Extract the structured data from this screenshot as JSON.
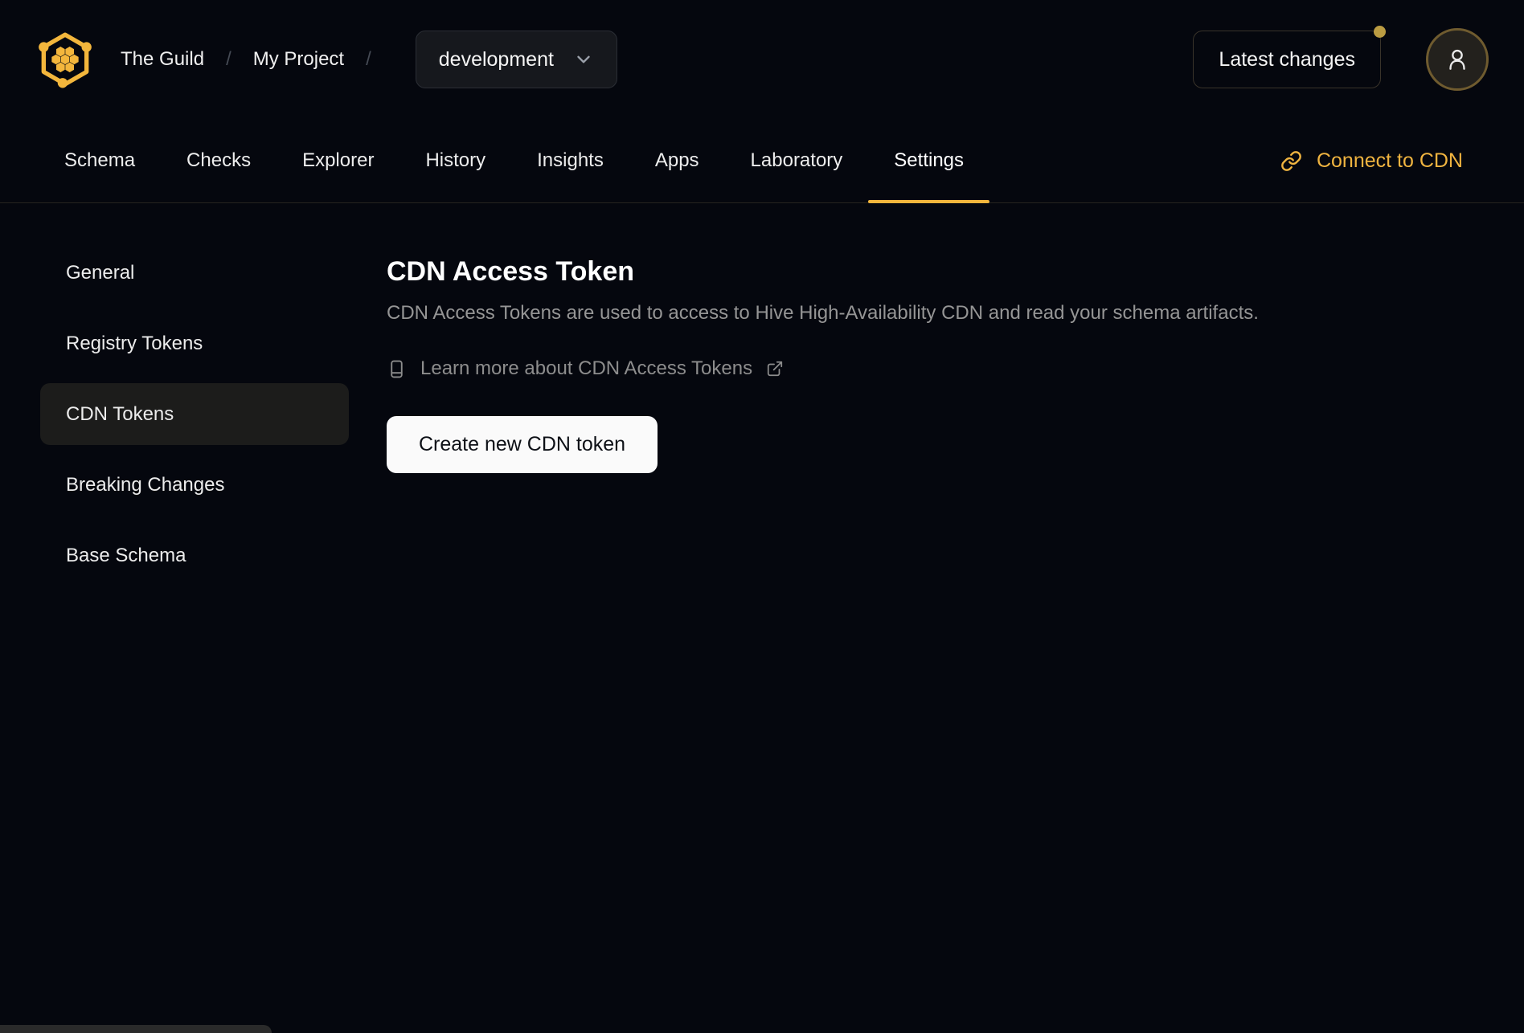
{
  "app": {
    "accent_color": "#f3b63c",
    "background_color": "#05070e"
  },
  "header": {
    "logo_name": "hive-honeycomb-logo",
    "org": "The Guild",
    "separator": "/",
    "project": "My Project",
    "environment": {
      "selected": "development"
    },
    "latest_changes": {
      "label": "Latest changes",
      "has_notification_dot": true,
      "dot_color": "#bb9c42"
    }
  },
  "nav": {
    "tabs": [
      {
        "label": "Schema"
      },
      {
        "label": "Checks"
      },
      {
        "label": "Explorer"
      },
      {
        "label": "History"
      },
      {
        "label": "Insights"
      },
      {
        "label": "Apps"
      },
      {
        "label": "Laboratory"
      },
      {
        "label": "Settings",
        "active": true
      }
    ],
    "connect_cdn": {
      "label": "Connect to CDN",
      "color": "#f0b440",
      "icon": "link-chain-icon"
    }
  },
  "sidebar": {
    "items": [
      {
        "label": "General"
      },
      {
        "label": "Registry Tokens"
      },
      {
        "label": "CDN Tokens",
        "active": true
      },
      {
        "label": "Breaking Changes"
      },
      {
        "label": "Base Schema"
      }
    ]
  },
  "main": {
    "title": "CDN Access Token",
    "description": "CDN Access Tokens are used to access to Hive High-Availability CDN and read your schema artifacts.",
    "learn_more": {
      "label": "Learn more about CDN Access Tokens",
      "leading_icon": "book-icon",
      "trailing_icon": "external-link-icon"
    },
    "create_token_button": {
      "label": "Create new CDN token"
    }
  }
}
